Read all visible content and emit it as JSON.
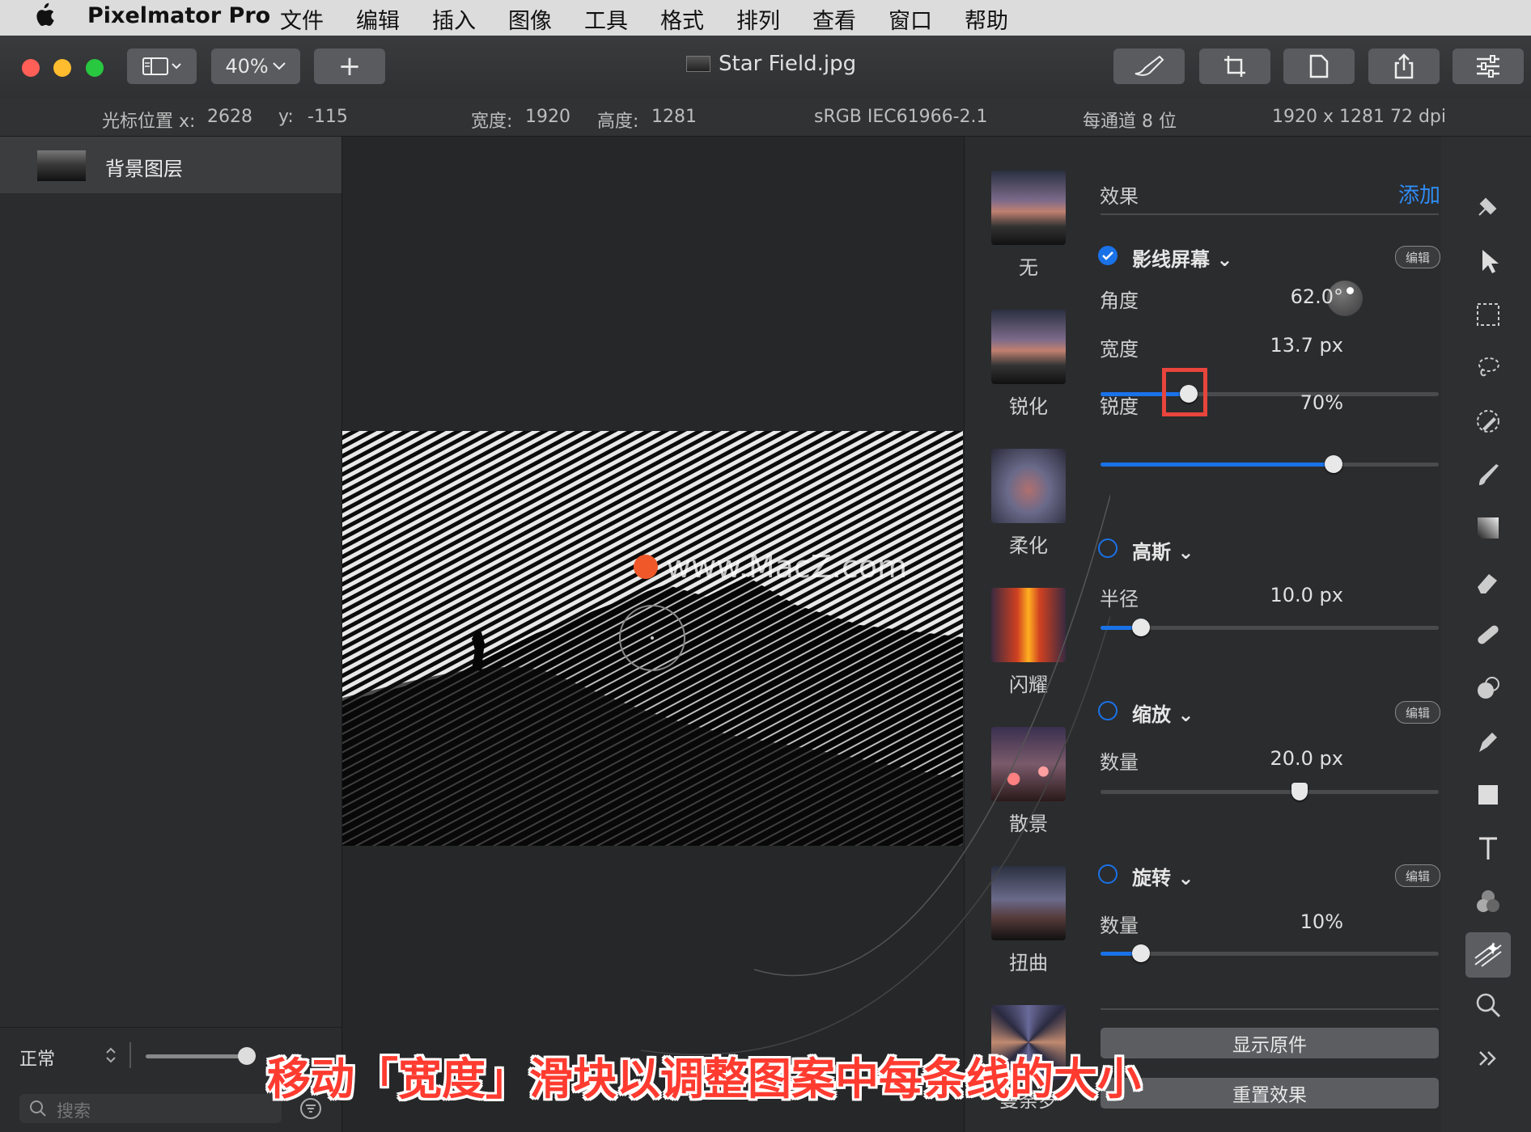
{
  "menubar": {
    "app_name": "Pixelmator Pro",
    "items": [
      "文件",
      "编辑",
      "插入",
      "图像",
      "工具",
      "格式",
      "排列",
      "查看",
      "窗口",
      "帮助"
    ]
  },
  "toolbar": {
    "zoom": "40%",
    "add_label": "+",
    "document_title": "Star Field.jpg"
  },
  "infobar": {
    "cursor_label": "光标位置 x:",
    "cursor_x": "2628",
    "cursor_y_label": "y:",
    "cursor_y": "-115",
    "width_label": "宽度:",
    "width": "1920",
    "height_label": "高度:",
    "height": "1281",
    "color_profile": "sRGB IEC61966-2.1",
    "bit_depth": "每通道 8 位",
    "resolution": "1920 x 1281 72 dpi"
  },
  "layers": {
    "layer_name": "背景图层",
    "blend_mode": "正常",
    "opacity_fraction": 1.0,
    "search_placeholder": "搜索"
  },
  "canvas": {
    "watermark": "www.MacZ.com"
  },
  "effects": {
    "header": "效果",
    "add_label": "添加",
    "edit_badge": "编辑",
    "presets": [
      "无",
      "锐化",
      "柔化",
      "闪耀",
      "散景",
      "扭曲",
      "曼荼罗"
    ],
    "line_screen": {
      "title": "影线屏幕",
      "enabled": true,
      "angle_label": "角度",
      "angle_value": "62.0°",
      "width_label": "宽度",
      "width_value": "13.7 px",
      "width_fraction": 0.26,
      "sharpness_label": "锐度",
      "sharpness_value": "70%",
      "sharpness_fraction": 0.69
    },
    "gaussian": {
      "title": "高斯",
      "enabled": false,
      "radius_label": "半径",
      "radius_value": "10.0 px",
      "radius_fraction": 0.12
    },
    "zoom": {
      "title": "缩放",
      "enabled": false,
      "amount_label": "数量",
      "amount_value": "20.0 px",
      "amount_fraction": 0.59
    },
    "twirl": {
      "title": "旋转",
      "enabled": false,
      "amount_label": "数量",
      "amount_value": "10%",
      "amount_fraction": 0.12
    },
    "show_original_label": "显示原件",
    "reset_label": "重置效果"
  },
  "colors": {
    "accent": "#1a72e8",
    "highlight": "#ff3b30"
  },
  "tools": [
    "arrange-icon",
    "pointer-icon",
    "selection-icon",
    "lasso-icon",
    "color-picker-icon",
    "paint-icon",
    "gradient-icon",
    "eraser-icon",
    "repair-icon",
    "clone-icon",
    "pen-icon",
    "shape-icon",
    "text-icon",
    "color-adjust-icon",
    "effects-icon",
    "zoom-icon",
    "more-icon"
  ],
  "caption": "移动「宽度」滑块以调整图案中每条线的大小"
}
